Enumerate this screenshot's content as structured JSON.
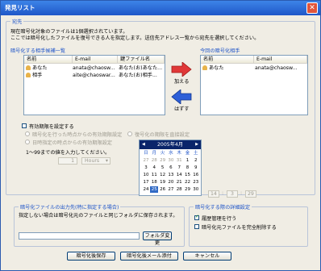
{
  "title": "発見リスト",
  "recipients_group": {
    "title": "宛先",
    "desc1": "現在暗号化対象のファイルは1個選択されています。",
    "desc2": "ここでは暗号化したファイルを復号できる人を指定します。送信先アドレス一覧から宛先を選択してください。"
  },
  "candidates": {
    "title": "暗号化する相手候補一覧",
    "columns": [
      "名前",
      "E-mail",
      "鍵ファイル名"
    ],
    "rows": [
      [
        "あなた",
        "anata@chaosw...",
        "あなた(お)あなた..."
      ],
      [
        "相手",
        "aite@chaoswar...",
        "あなた(お)相手..."
      ]
    ]
  },
  "add_label": "加える",
  "remove_label": "はずす",
  "current": {
    "title": "今回の暗号化相手",
    "columns": [
      "名前",
      "E-mail"
    ],
    "rows": [
      [
        "あなた",
        "anata@chaosw..."
      ]
    ]
  },
  "expiry": {
    "checkbox_label": "有効期限を設定する",
    "radio1": "暗号化を行った時点からの有効期限設定",
    "radio2": "日時指定の時点からの有効期限設定",
    "radio3": "復号化の期限を直接設定",
    "hint": "1〜99までの値を入力してください。",
    "number": "1",
    "unit": "Hours",
    "cal_title": "2005年4月",
    "weekdays": [
      "日",
      "月",
      "火",
      "水",
      "木",
      "金",
      "土"
    ],
    "days": [
      [
        "27",
        "28",
        "29",
        "30",
        "31",
        "1",
        "2"
      ],
      [
        "3",
        "4",
        "5",
        "6",
        "7",
        "8",
        "9"
      ],
      [
        "10",
        "11",
        "12",
        "13",
        "14",
        "15",
        "16"
      ],
      [
        "17",
        "18",
        "19",
        "20",
        "21",
        "22",
        "23"
      ],
      [
        "24",
        "25",
        "26",
        "27",
        "28",
        "29",
        "30"
      ]
    ],
    "time": [
      "14",
      "3",
      "29"
    ]
  },
  "output": {
    "title": "暗号化ファイルの出力先(特に指定する場合)",
    "desc": "指定しない場合は暗号化元のファイルと同じフォルダに保存されます。",
    "folder_btn": "フォルダ変更"
  },
  "detail": {
    "title": "暗号化する際の詳細設定",
    "chk1": "履歴管理を行う",
    "chk2": "暗号化元ファイルを完全削除する"
  },
  "buttons": {
    "save": "暗号化後保存",
    "mail": "暗号化後メール添付",
    "cancel": "キャンセル"
  },
  "colors": {
    "titlebar": "#1f57c8",
    "group_title": "#1b52c8",
    "arrow_add": "#e03838",
    "arrow_remove": "#2d5fd8"
  }
}
